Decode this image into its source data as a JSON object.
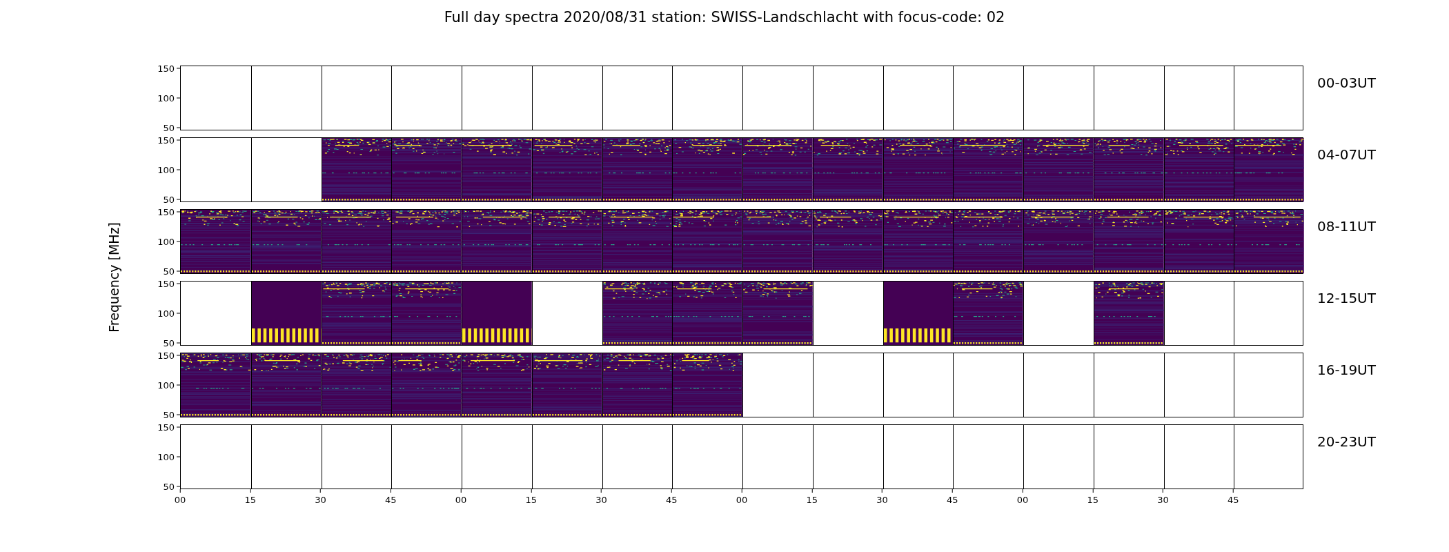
{
  "title": "Full day spectra 2020/08/31 station: SWISS-Landschlacht with focus-code: 02",
  "ylabel": "Frequency [MHz]",
  "rows": [
    {
      "label": "00-03UT",
      "yticks": [
        "150",
        "100",
        "50"
      ],
      "panels": [
        {
          "kind": "empty"
        },
        {
          "kind": "empty"
        },
        {
          "kind": "empty"
        },
        {
          "kind": "empty"
        },
        {
          "kind": "empty"
        },
        {
          "kind": "empty"
        },
        {
          "kind": "empty"
        },
        {
          "kind": "empty"
        },
        {
          "kind": "empty"
        },
        {
          "kind": "empty"
        },
        {
          "kind": "empty"
        },
        {
          "kind": "empty"
        },
        {
          "kind": "empty"
        },
        {
          "kind": "empty"
        },
        {
          "kind": "empty"
        },
        {
          "kind": "empty"
        }
      ]
    },
    {
      "label": "04-07UT",
      "yticks": [
        "150",
        "100",
        "50"
      ],
      "panels": [
        {
          "kind": "empty"
        },
        {
          "kind": "empty"
        },
        {
          "kind": "spectrum"
        },
        {
          "kind": "spectrum"
        },
        {
          "kind": "spectrum"
        },
        {
          "kind": "spectrum"
        },
        {
          "kind": "spectrum"
        },
        {
          "kind": "spectrum"
        },
        {
          "kind": "spectrum"
        },
        {
          "kind": "spectrum"
        },
        {
          "kind": "spectrum"
        },
        {
          "kind": "spectrum"
        },
        {
          "kind": "spectrum"
        },
        {
          "kind": "spectrum"
        },
        {
          "kind": "spectrum"
        },
        {
          "kind": "spectrum"
        }
      ]
    },
    {
      "label": "08-11UT",
      "yticks": [
        "150",
        "100",
        "50"
      ],
      "panels": [
        {
          "kind": "spectrum"
        },
        {
          "kind": "spectrum"
        },
        {
          "kind": "spectrum"
        },
        {
          "kind": "spectrum"
        },
        {
          "kind": "spectrum"
        },
        {
          "kind": "spectrum"
        },
        {
          "kind": "spectrum"
        },
        {
          "kind": "spectrum"
        },
        {
          "kind": "spectrum"
        },
        {
          "kind": "spectrum"
        },
        {
          "kind": "spectrum"
        },
        {
          "kind": "spectrum"
        },
        {
          "kind": "spectrum"
        },
        {
          "kind": "spectrum"
        },
        {
          "kind": "spectrum"
        },
        {
          "kind": "spectrum"
        }
      ]
    },
    {
      "label": "12-15UT",
      "yticks": [
        "150",
        "100",
        "50"
      ],
      "panels": [
        {
          "kind": "empty"
        },
        {
          "kind": "calibration"
        },
        {
          "kind": "spectrum"
        },
        {
          "kind": "spectrum"
        },
        {
          "kind": "calibration"
        },
        {
          "kind": "empty"
        },
        {
          "kind": "spectrum"
        },
        {
          "kind": "spectrum"
        },
        {
          "kind": "spectrum"
        },
        {
          "kind": "empty"
        },
        {
          "kind": "calibration"
        },
        {
          "kind": "spectrum"
        },
        {
          "kind": "empty"
        },
        {
          "kind": "spectrum"
        },
        {
          "kind": "empty"
        },
        {
          "kind": "empty"
        }
      ]
    },
    {
      "label": "16-19UT",
      "yticks": [
        "150",
        "100",
        "50"
      ],
      "panels": [
        {
          "kind": "spectrum"
        },
        {
          "kind": "spectrum"
        },
        {
          "kind": "spectrum"
        },
        {
          "kind": "spectrum"
        },
        {
          "kind": "spectrum"
        },
        {
          "kind": "spectrum"
        },
        {
          "kind": "spectrum"
        },
        {
          "kind": "spectrum"
        },
        {
          "kind": "empty"
        },
        {
          "kind": "empty"
        },
        {
          "kind": "empty"
        },
        {
          "kind": "empty"
        },
        {
          "kind": "empty"
        },
        {
          "kind": "empty"
        },
        {
          "kind": "empty"
        },
        {
          "kind": "empty"
        }
      ]
    },
    {
      "label": "20-23UT",
      "yticks": [
        "150",
        "100",
        "50"
      ],
      "panels": [
        {
          "kind": "empty"
        },
        {
          "kind": "empty"
        },
        {
          "kind": "empty"
        },
        {
          "kind": "empty"
        },
        {
          "kind": "empty"
        },
        {
          "kind": "empty"
        },
        {
          "kind": "empty"
        },
        {
          "kind": "empty"
        },
        {
          "kind": "empty"
        },
        {
          "kind": "empty"
        },
        {
          "kind": "empty"
        },
        {
          "kind": "empty"
        },
        {
          "kind": "empty"
        },
        {
          "kind": "empty"
        },
        {
          "kind": "empty"
        },
        {
          "kind": "empty"
        }
      ]
    }
  ],
  "xticks": [
    "00",
    "15",
    "30",
    "45",
    "00",
    "15",
    "30",
    "45",
    "00",
    "15",
    "30",
    "45",
    "00",
    "15",
    "30",
    "45"
  ]
}
